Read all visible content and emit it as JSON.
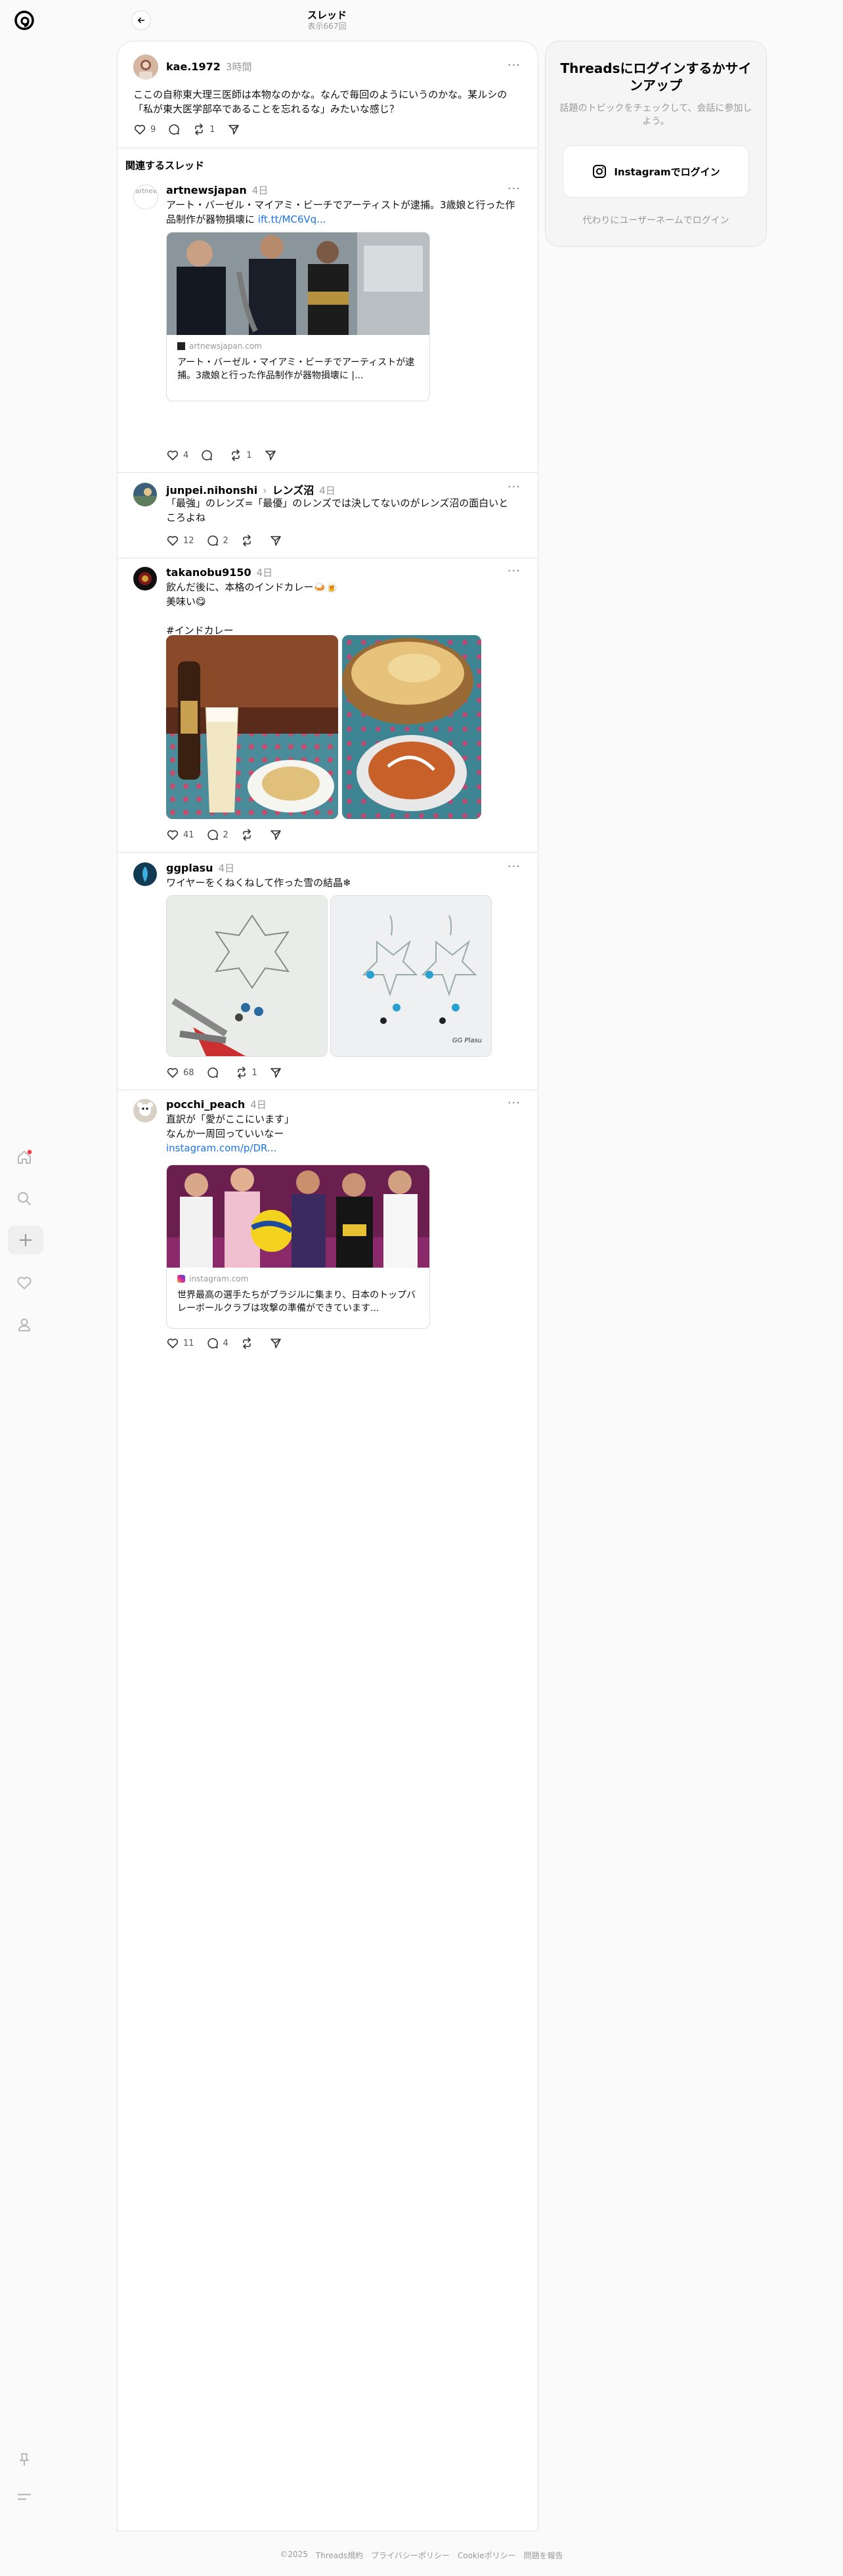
{
  "header": {
    "title": "スレッド",
    "views": "表示667回"
  },
  "colors": {
    "accent": "#1a73e8",
    "notification": "#ff3040"
  },
  "sidebar": {
    "icons": [
      "threads-logo-icon",
      "home-icon",
      "search-icon",
      "create-icon",
      "heart-icon",
      "profile-icon",
      "pin-icon",
      "menu-icon"
    ]
  },
  "main_post": {
    "username": "kae.1972",
    "time": "3時間",
    "text": "ここの自称東大理三医師は本物なのかな。なんで毎回のようにいうのかな。某ルシの「私が東大医学部卒であることを忘れるな」みたいな感じ？",
    "likes": "9",
    "reposts": "1"
  },
  "related_heading": "関連するスレッド",
  "posts": [
    {
      "username": "artnewsjapan",
      "time": "4日",
      "text": "アート・バーゼル・マイアミ・ビーチでアーティストが逮捕。3歳娘と行った作品制作が器物損壊に",
      "link": "ift.tt/MC6Vq...",
      "avatar_alt": "artnewsjapan",
      "card_source": "artnewsjapan.com",
      "card_title": "アート・バーゼル・マイアミ・ビーチでアーティストが逮捕。3歳娘と行った作品制作が器物損壊に |...",
      "likes": "4",
      "comments": "",
      "reposts": "1"
    },
    {
      "username": "junpei.nihonshi",
      "topic": "レンズ沼",
      "time": "4日",
      "text": "「最強」のレンズ=「最優」のレンズでは決してないのがレンズ沼の面白いところよね",
      "likes": "12",
      "comments": "2",
      "reposts": ""
    },
    {
      "username": "takanobu9150",
      "time": "4日",
      "text_lines": [
        "飲んだ後に、本格のインドカレー🍛🍺",
        "美味い😋",
        "",
        "#インドカレー"
      ],
      "likes": "41",
      "comments": "2",
      "reposts": ""
    },
    {
      "username": "ggplasu",
      "time": "4日",
      "text": "ワイヤーをくねくねして作った雪の結晶❄",
      "likes": "68",
      "comments": "",
      "reposts": "1",
      "watermark": "GG Plasu"
    },
    {
      "username": "pocchi_peach",
      "time": "4日",
      "text_lines": [
        "直訳が「愛がここにいます」",
        "なんか一周回っていいなー"
      ],
      "link": "instagram.com/p/DR...",
      "card_source": "instagram.com",
      "card_title": "世界最高の選手たちがブラジルに集まり、日本のトップバレーボールクラブは攻撃の準備ができています...",
      "likes": "11",
      "comments": "4",
      "reposts": ""
    }
  ],
  "login_panel": {
    "title": "Threadsにログインするかサインアップ",
    "subtitle": "話題のトピックをチェックして、会話に参加しよう。",
    "button": "Instagramでログイン",
    "alt": "代わりにユーザーネームでログイン"
  },
  "footer": [
    "©2025",
    "Threads規約",
    "プライバシーポリシー",
    "Cookieポリシー",
    "問題を報告"
  ]
}
